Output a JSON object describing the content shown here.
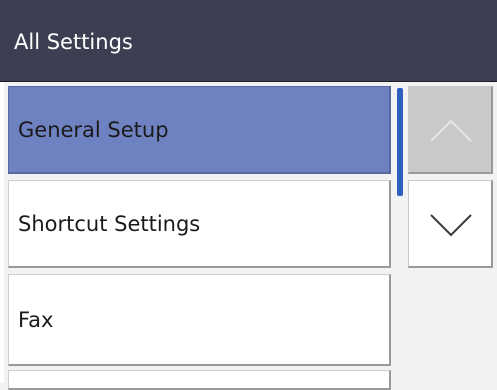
{
  "header": {
    "title": "All Settings"
  },
  "menu": {
    "items": [
      {
        "label": "General Setup",
        "selected": true
      },
      {
        "label": "Shortcut Settings",
        "selected": false
      },
      {
        "label": "Fax",
        "selected": false
      }
    ]
  },
  "scroll": {
    "up_icon": "chevron-up-icon",
    "down_icon": "chevron-down-icon",
    "up_enabled": false,
    "down_enabled": true
  },
  "colors": {
    "header_bg": "#3c3f52",
    "selected_bg": "#6e82c2",
    "scroll_indicator": "#2f5fbf"
  }
}
